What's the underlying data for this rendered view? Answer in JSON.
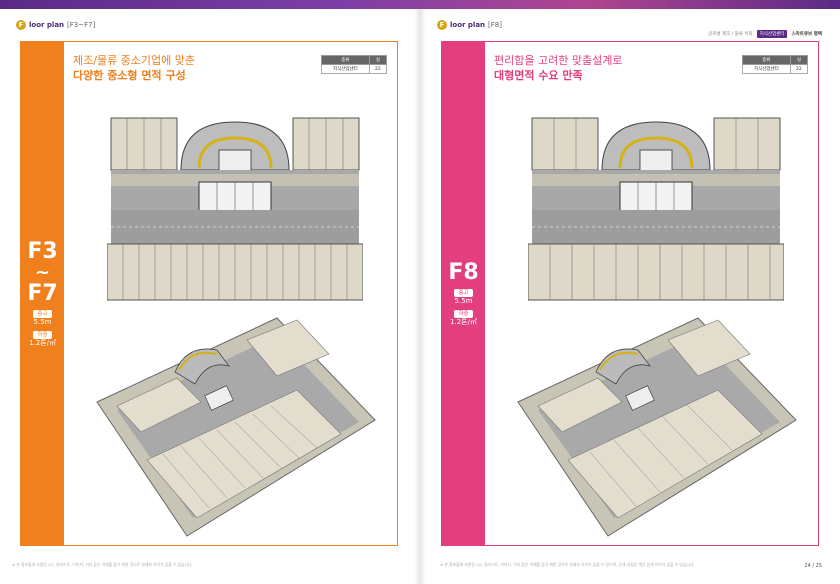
{
  "left_page": {
    "fp_label": "loor plan",
    "fp_initial": "F",
    "fp_range": "[F3~F7]",
    "floor": {
      "top": "F3",
      "tilde": "~",
      "bottom": "F7"
    },
    "ceiling": {
      "label": "층고",
      "value": "5.5m"
    },
    "load": {
      "label": "하중",
      "value": "1.2톤/㎡"
    },
    "headline_1": "제조/물류 중소기업에 맞춘",
    "headline_2": "다양한 중소형 면적 구성",
    "spec": {
      "col1": "종류",
      "col2": "실",
      "use": "지식산업센터",
      "count": "22"
    },
    "footnote": "※ 본 홍보물에 사용된 CG, 일러스트, 이미지, 기타 등은 이해를 돕기 위한 것으로 실제와 차이가 있을 수 있습니다."
  },
  "right_page": {
    "fp_label": "loor plan",
    "fp_initial": "F",
    "fp_range": "[F8]",
    "header_links": [
      "글로벌 제조 / 물류 특화",
      "지식산업센터",
      "스마트큐브 평택"
    ],
    "floor": {
      "name": "F8"
    },
    "ceiling": {
      "label": "층고",
      "value": "5.5m"
    },
    "load": {
      "label": "하중",
      "value": "1.2톤/㎡"
    },
    "headline_1": "편리함을 고려한 맞춤설계로",
    "headline_2": "대형면적 수요 만족",
    "spec": {
      "col1": "종류",
      "col2": "실",
      "use": "지식산업센터",
      "count": "22"
    },
    "footnote": "※ 본 홍보물에 사용된 CG, 일러스트, 이미지, 기타 등은 이해를 돕기 위한 것으로 실제와 차이가 있을 수 있으며, 인쇄 과정상 색상 등에 차이가 있을 수 있습니다.",
    "page_number": "24 / 25"
  },
  "colors": {
    "orange": "#f07f1e",
    "pink": "#e33f7f",
    "purple": "#5a2a86"
  }
}
